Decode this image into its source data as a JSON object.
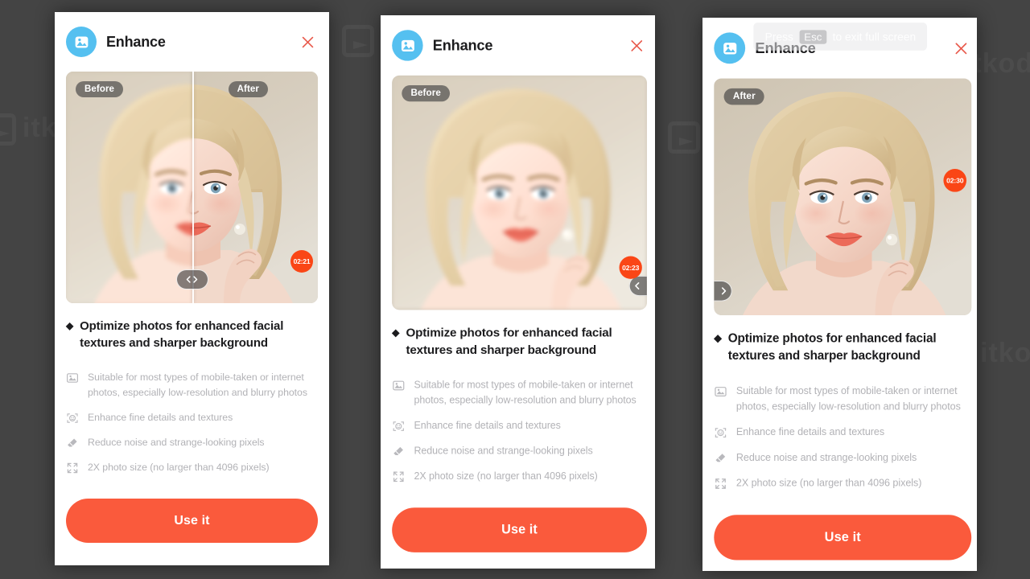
{
  "background": {
    "color": "#444444",
    "watermark_text": "itkoding"
  },
  "colors": {
    "accent_orange": "#fa5a3c",
    "timer_badge": "#fa4616",
    "app_icon_blue": "#55c0f0",
    "close_red": "#e8584a",
    "feature_text_gray": "#b2b2b6"
  },
  "dialog": {
    "app_icon": "photo-enhance-icon",
    "title": "Enhance",
    "close_icon": "close-icon",
    "compare": {
      "before_label": "Before",
      "after_label": "After",
      "handle_icon": "compare-slider-handle",
      "left_arrow_icon": "chevron-left-icon",
      "right_arrow_icon": "chevron-right-icon"
    },
    "headline_bullet": "◆",
    "headline": "Optimize photos for enhanced facial textures and sharper background",
    "features": [
      {
        "icon": "image-icon",
        "text": "Suitable for most types of mobile-taken or internet photos, especially low-resolution and blurry photos"
      },
      {
        "icon": "face-scan-icon",
        "text": "Enhance fine details and textures"
      },
      {
        "icon": "eraser-icon",
        "text": "Reduce noise and strange-looking pixels"
      },
      {
        "icon": "expand-icon",
        "text": "2X photo size (no larger than 4096 pixels)"
      }
    ],
    "cta_label": "Use it"
  },
  "panels": [
    {
      "id": "panel-1",
      "state": "split-compare",
      "timer": "02:21",
      "tooltip": null
    },
    {
      "id": "panel-2",
      "state": "before-only",
      "timer": "02:23",
      "tooltip": null
    },
    {
      "id": "panel-3",
      "state": "after-only",
      "timer": "02:30",
      "tooltip": {
        "prefix": "Press",
        "key": "Esc",
        "suffix": "to exit full screen"
      }
    }
  ]
}
